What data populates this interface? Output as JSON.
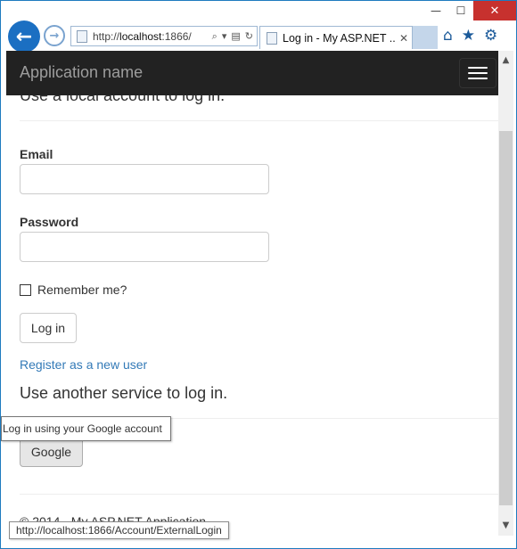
{
  "window": {
    "min_glyph": "—",
    "max_glyph": "☐",
    "close_glyph": "✕"
  },
  "browser": {
    "address": {
      "prefix": "http://",
      "host": "localhost",
      "rest": ":1866/"
    },
    "tab": {
      "title": "Log in - My ASP.NET ...",
      "close_glyph": "✕"
    },
    "icons": {
      "back": "arrow-left-icon",
      "forward": "arrow-right-icon",
      "search": "search-icon",
      "dropdown": "chevron-down-icon",
      "compat": "compatibility-icon",
      "refresh": "refresh-icon",
      "home": "home-icon",
      "favorites": "star-icon",
      "tools": "gear-icon"
    }
  },
  "navbar": {
    "brand": "Application name"
  },
  "page": {
    "local_heading": "Use a local account to log in.",
    "email_label": "Email",
    "email_value": "",
    "password_label": "Password",
    "password_value": "",
    "remember_label": "Remember me?",
    "remember_checked": false,
    "login_button": "Log in",
    "register_link": "Register as a new user",
    "external_heading": "Use another service to log in.",
    "google_button": "Google",
    "footer": "© 2014 - My ASP.NET Application"
  },
  "tooltip": "Log in using your Google account",
  "status_url": "http://localhost:1866/Account/ExternalLogin",
  "colors": {
    "navbar_bg": "#222222",
    "brand_text": "#9d9d9d",
    "link": "#337ab7",
    "close_button": "#c7312e",
    "back_button": "#1b6fc2"
  }
}
